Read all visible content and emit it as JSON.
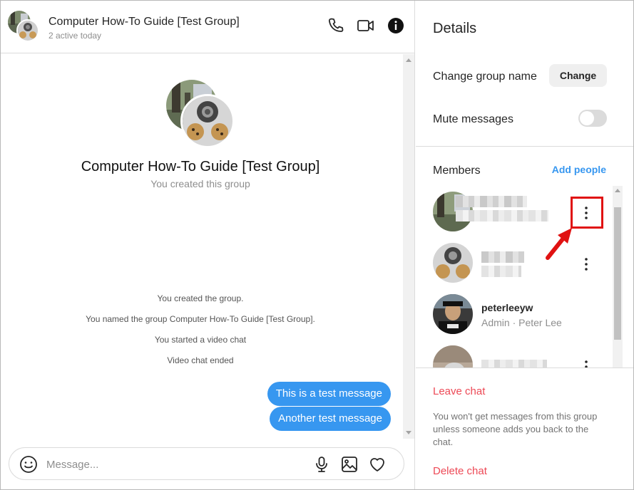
{
  "header": {
    "title": "Computer How-To Guide [Test Group]",
    "subtitle": "2 active today",
    "icons": [
      "phone-icon",
      "video-camera-icon",
      "info-icon"
    ]
  },
  "thread": {
    "group_name": "Computer How-To Guide [Test Group]",
    "group_sub": "You created this group",
    "system_messages": [
      "You created the group.",
      "You named the group Computer How-To Guide [Test Group].",
      "You started a video chat",
      "Video chat ended"
    ],
    "messages": [
      "This is a test message",
      "Another test message"
    ]
  },
  "composer": {
    "placeholder": "Message...",
    "icons": [
      "emoji-icon",
      "microphone-icon",
      "image-icon",
      "heart-icon"
    ]
  },
  "details": {
    "title": "Details",
    "change_group_name_label": "Change group name",
    "change_button": "Change",
    "mute_label": "Mute messages",
    "mute_on": false,
    "members_label": "Members",
    "add_people": "Add people",
    "members": [
      {
        "name": "",
        "sub": "",
        "blurred": true
      },
      {
        "name": "",
        "sub": "",
        "blurred": true
      },
      {
        "name": "peterleeyw",
        "sub": "Admin · Peter Lee",
        "blurred": false
      },
      {
        "name": "",
        "sub": "",
        "blurred": true
      }
    ],
    "leave_chat": "Leave chat",
    "leave_note": "You won't get messages from this group unless someone adds you back to the chat.",
    "delete_chat": "Delete chat"
  },
  "colors": {
    "accent_blue": "#3797f0",
    "danger_red": "#ed4956",
    "annotation_red": "#e01212"
  }
}
